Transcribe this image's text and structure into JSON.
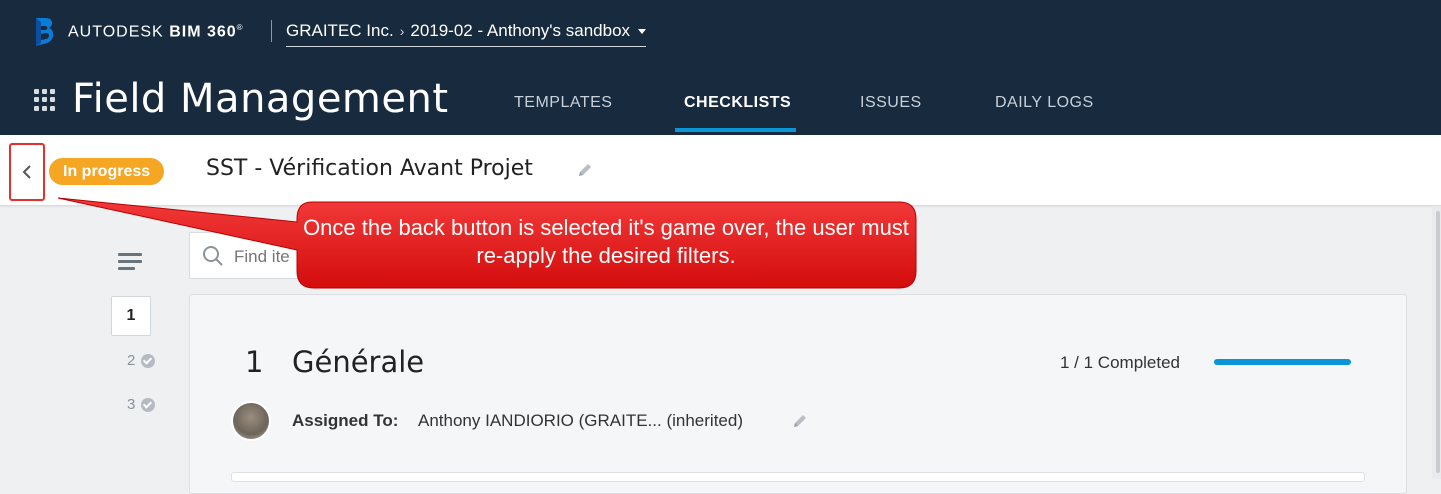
{
  "brand": {
    "name_prefix": "AUTODESK",
    "name_product": "BIM 360",
    "trademark": "®"
  },
  "project_selector": {
    "company": "GRAITEC Inc.",
    "separator": "›",
    "project": "2019-02 - Anthony's sandbox"
  },
  "app": {
    "title": "Field Management"
  },
  "tabs": [
    {
      "label": "TEMPLATES",
      "active": false
    },
    {
      "label": "CHECKLISTS",
      "active": true
    },
    {
      "label": "ISSUES",
      "active": false
    },
    {
      "label": "DAILY LOGS",
      "active": false
    }
  ],
  "checklist": {
    "status": "In progress",
    "title": "SST - Vérification Avant Projet"
  },
  "search": {
    "placeholder": "Find ite"
  },
  "sections_nav": [
    {
      "number": "1",
      "completed": false
    },
    {
      "number": "2",
      "completed": true
    },
    {
      "number": "3",
      "completed": true
    }
  ],
  "section": {
    "number": "1",
    "title": "Générale",
    "completed_text": "1 / 1 Completed",
    "progress_fraction": 1.0,
    "assigned_label": "Assigned To:",
    "assigned_value": "Anthony IANDIORIO (GRAITE...  (inherited)"
  },
  "annotation": {
    "text": "Once the back button is selected it's game over, the user must re-apply the desired filters."
  },
  "colors": {
    "topbar": "#182a3e",
    "accent": "#0a96d6",
    "status_pill": "#f5a623",
    "callout": "#e81414",
    "highlight_box": "#e53030"
  },
  "icons": [
    "bim360-logo-icon",
    "caret-down-icon",
    "apps-grid-icon",
    "chevron-left-icon",
    "pencil-icon",
    "search-icon",
    "list-icon",
    "check-circle-icon",
    "user-avatar"
  ]
}
